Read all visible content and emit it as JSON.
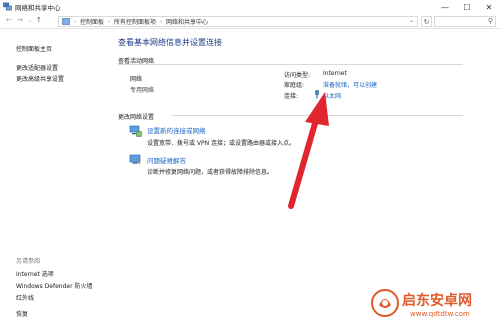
{
  "window": {
    "title": "网络和共享中心",
    "minimize": "—",
    "maximize": "☐",
    "close": "✕"
  },
  "address": {
    "back": "←",
    "forward": "→",
    "up": "↑",
    "crumbs": [
      "控制面板",
      "所有控制面板项",
      "网络和共享中心"
    ],
    "refresh": "↻",
    "search_icon": "⚲",
    "dropdown": "⌄",
    "recent": "⌄"
  },
  "sidebar": {
    "items": [
      {
        "label": "控制面板主页"
      },
      {
        "label": "更改适配器设置"
      },
      {
        "label": "更改高级共享设置"
      }
    ],
    "see_also_heading": "另请参阅",
    "see_also": [
      {
        "label": "Internet 选项"
      },
      {
        "label": "Windows Defender 防火墙"
      },
      {
        "label": "红外线"
      },
      {
        "label": "恢复"
      }
    ]
  },
  "main": {
    "title": "查看基本网络信息并设置连接",
    "active_section": "查看活动网络",
    "network_name": "网络",
    "network_type": "专用网络",
    "access_type_label": "访问类型:",
    "access_type_value": "Internet",
    "homegroup_label": "家庭组:",
    "homegroup_value": "准备就绪，可以创建",
    "connections_label": "连接:",
    "connections_value": "以太网",
    "change_section": "更改网络设置",
    "setup_link": "设置新的连接或网络",
    "setup_desc": "设置宽带、拨号或 VPN 连接；或设置路由器或接入点。",
    "troubleshoot_link": "问题疑难解答",
    "troubleshoot_desc": "诊断并修复网络问题，或者获得故障排除信息。"
  },
  "watermark": {
    "name": "启东安卓网",
    "url": "www.qdtdtw.com"
  },
  "colors": {
    "link": "#1a64c8",
    "title": "#1e3a8a",
    "arrow": "#e0262f"
  }
}
